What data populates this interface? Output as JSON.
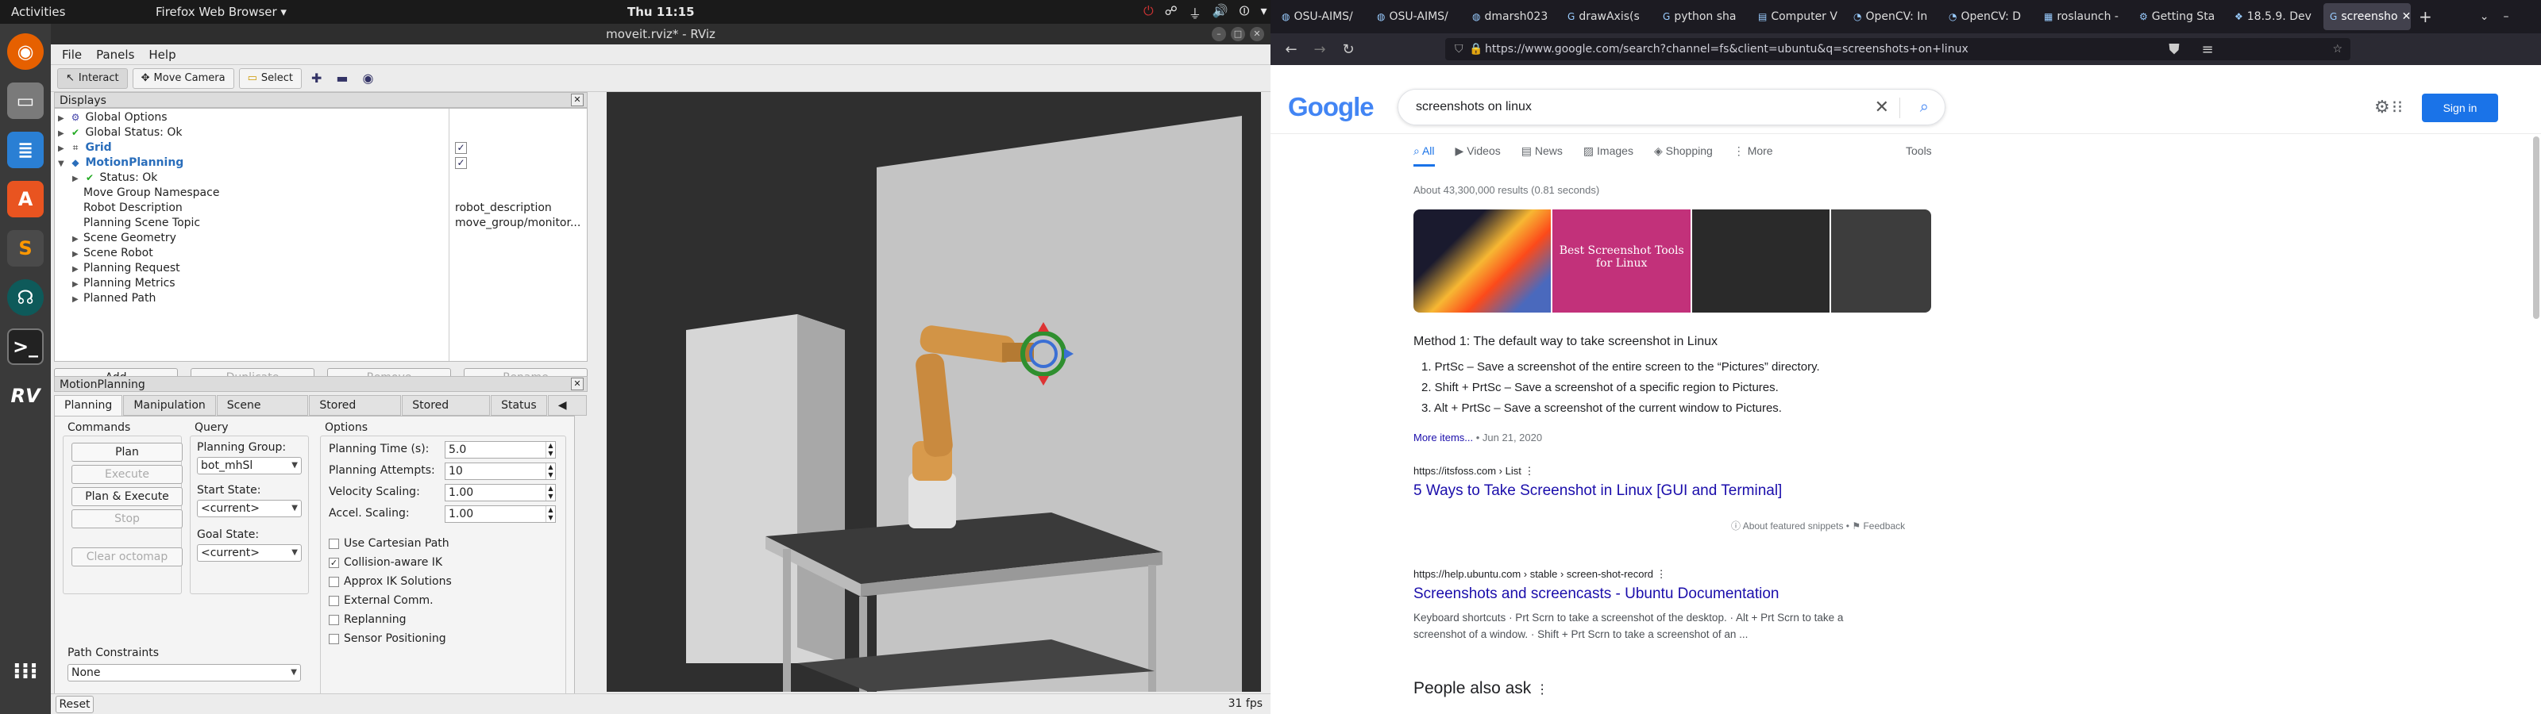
{
  "topbar": {
    "activities": "Activities",
    "app": "Firefox Web Browser ▾",
    "clock": "Thu 11:15",
    "tray": [
      "⏻",
      "☍",
      "⏚",
      "🔊",
      "⏼",
      "▾"
    ]
  },
  "dock": {
    "items": [
      "firefox-icon",
      "files-icon",
      "writer-icon",
      "software-icon",
      "sublime-icon",
      "gitkraken-icon",
      "terminal-icon",
      "rviz-icon",
      "apps-grid-icon"
    ]
  },
  "rviz": {
    "title": "moveit.rviz* - RViz",
    "menu": [
      "File",
      "Panels",
      "Help"
    ],
    "toolbar": {
      "interact": "Interact",
      "move_camera": "Move Camera",
      "select": "Select"
    },
    "displays": {
      "header": "Displays",
      "rows": [
        {
          "label": "Global Options",
          "value": ""
        },
        {
          "label": "Global Status: Ok",
          "value": ""
        },
        {
          "label": "Grid",
          "value": ""
        },
        {
          "label": "MotionPlanning",
          "value": ""
        },
        {
          "label": "Status: Ok",
          "value": ""
        },
        {
          "label": "Move Group Namespace",
          "value": ""
        },
        {
          "label": "Robot Description",
          "value": "robot_description"
        },
        {
          "label": "Planning Scene Topic",
          "value": "move_group/monitor..."
        },
        {
          "label": "Scene Geometry",
          "value": ""
        },
        {
          "label": "Scene Robot",
          "value": ""
        },
        {
          "label": "Planning Request",
          "value": ""
        },
        {
          "label": "Planning Metrics",
          "value": ""
        },
        {
          "label": "Planned Path",
          "value": ""
        }
      ],
      "buttons": [
        "Add",
        "Duplicate",
        "Remove",
        "Rename"
      ]
    },
    "motion": {
      "header": "MotionPlanning",
      "tabs": [
        "Planning",
        "Manipulation",
        "Scene Objects",
        "Stored Scenes",
        "Stored States",
        "Status"
      ],
      "commands_label": "Commands",
      "plan": "Plan",
      "execute": "Execute",
      "plan_execute": "Plan & Execute",
      "stop": "Stop",
      "clear_octomap": "Clear octomap",
      "query_label": "Query",
      "planning_group_label": "Planning Group:",
      "planning_group": "bot_mhSl",
      "start_state_label": "Start State:",
      "start_state": "<current>",
      "goal_state_label": "Goal State:",
      "goal_state": "<current>",
      "options_label": "Options",
      "planning_time_label": "Planning Time (s):",
      "planning_time": "5.0",
      "planning_attempts_label": "Planning Attempts:",
      "planning_attempts": "10",
      "velocity_label": "Velocity Scaling:",
      "velocity": "1.00",
      "accel_label": "Accel. Scaling:",
      "accel": "1.00",
      "checkboxes": [
        {
          "label": "Use Cartesian Path",
          "checked": false
        },
        {
          "label": "Collision-aware IK",
          "checked": true
        },
        {
          "label": "Approx IK Solutions",
          "checked": false
        },
        {
          "label": "External Comm.",
          "checked": false
        },
        {
          "label": "Replanning",
          "checked": false
        },
        {
          "label": "Sensor Positioning",
          "checked": false
        }
      ],
      "path_constraints_label": "Path Constraints",
      "path_constraints": "None"
    },
    "status": {
      "reset": "Reset",
      "fps": "31 fps"
    }
  },
  "firefox": {
    "tabs": [
      "OSU-AIMS/",
      "OSU-AIMS/",
      "dmarsh023",
      "drawAxis(s",
      "python sha",
      "Computer V",
      "OpenCV: In",
      "OpenCV: D",
      "roslaunch -",
      "Getting Sta",
      "18.5.9. Dev",
      "screensho"
    ],
    "url": "https://www.google.com/search?channel=fs&client=ubuntu&q=screenshots+on+linux",
    "nav": {
      "back": "←",
      "forward": "→",
      "reload": "↻"
    }
  },
  "google": {
    "logo": "Google",
    "query": "screenshots on linux",
    "tabs": [
      "All",
      "Videos",
      "News",
      "Images",
      "Shopping",
      "More"
    ],
    "tools": "Tools",
    "signin": "Sign in",
    "stats": "About 43,300,000 results (0.81 seconds)",
    "image_caption": "Best Screenshot Tools for Linux",
    "snippet_heading": "Method 1: The default way to take screenshot in Linux",
    "snippet_items": [
      "1. PrtSc – Save a screenshot of the entire screen to the “Pictures” directory.",
      "2. Shift + PrtSc – Save a screenshot of a specific region to Pictures.",
      "3. Alt + PrtSc – Save a screenshot of the current window to Pictures."
    ],
    "more_items": "More items...",
    "date": "• Jun 21, 2020",
    "result1": {
      "cite": "https://itsfoss.com › List",
      "title": "5 Ways to Take Screenshot in Linux [GUI and Terminal]"
    },
    "featured": "About featured snippets",
    "feedback": "Feedback",
    "result2": {
      "cite": "https://help.ubuntu.com › stable › screen-shot-record",
      "title": "Screenshots and screencasts - Ubuntu Documentation",
      "snippet": "Keyboard shortcuts · Prt Scrn to take a screenshot of the desktop. · Alt + Prt Scrn to take a screenshot of a window. · Shift + Prt Scrn to take a screenshot of an ..."
    },
    "paa": "People also ask"
  }
}
